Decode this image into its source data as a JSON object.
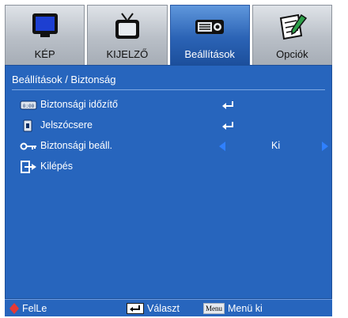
{
  "tabs": [
    {
      "label": "KÉP",
      "icon": "monitor-icon",
      "active": false
    },
    {
      "label": "KIJELZŐ",
      "icon": "tv-icon",
      "active": false
    },
    {
      "label": "Beállítások",
      "icon": "projector-icon",
      "active": true
    },
    {
      "label": "Opciók",
      "icon": "notepad-pen-icon",
      "active": false
    }
  ],
  "breadcrumb": "Beállítások / Biztonság",
  "menu": [
    {
      "label": "Biztonsági időzítő",
      "icon": "timer-icon",
      "action": "enter"
    },
    {
      "label": "Jelszócsere",
      "icon": "password-icon",
      "action": "enter"
    },
    {
      "label": "Biztonsági beáll.",
      "icon": "key-icon",
      "action": "select",
      "value": "Ki"
    },
    {
      "label": "Kilépés",
      "icon": "exit-icon",
      "action": "none"
    }
  ],
  "footer": {
    "nav_label": "FelLe",
    "select_label": "Választ",
    "menu_button_label": "Menu",
    "menu_exit_label": "Menü ki"
  },
  "colors": {
    "panel": "#2765bd",
    "active_tab": "#2b63b5",
    "text": "#ffffff",
    "arrow": "#2f80ff",
    "nav_diamond": "#e53935"
  }
}
